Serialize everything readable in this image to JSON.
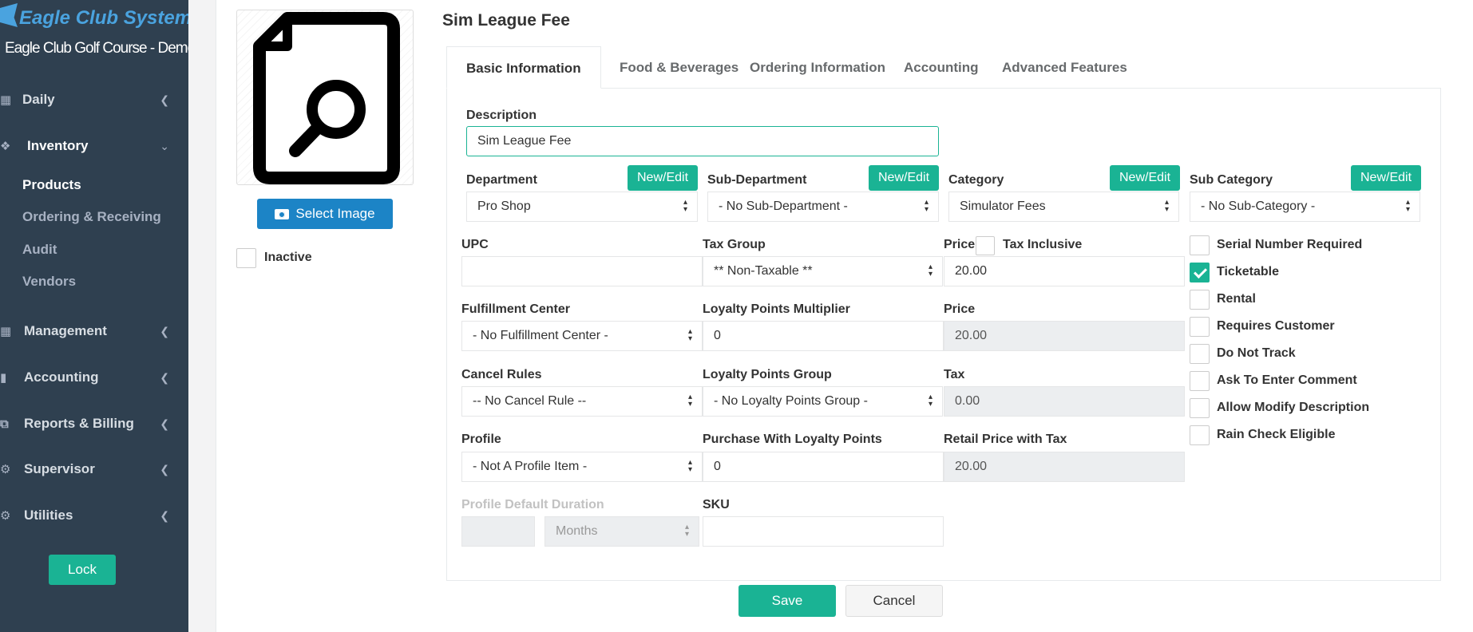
{
  "brand": {
    "name": "Eagle Club Systems",
    "subtitle": "Eagle Club Golf Course - Demo"
  },
  "sidebar": {
    "items": [
      {
        "label": "Daily",
        "icon": "calendar-icon"
      },
      {
        "label": "Inventory",
        "icon": "cubes-icon"
      },
      {
        "label": "Management",
        "icon": "grid-icon"
      },
      {
        "label": "Accounting",
        "icon": "bar-chart-icon"
      },
      {
        "label": "Reports & Billing",
        "icon": "copy-icon"
      },
      {
        "label": "Supervisor",
        "icon": "gear-icon"
      },
      {
        "label": "Utilities",
        "icon": "gear-icon"
      }
    ],
    "inventory_subitems": [
      {
        "label": "Products"
      },
      {
        "label": "Ordering & Receiving"
      },
      {
        "label": "Audit"
      },
      {
        "label": "Vendors"
      }
    ],
    "lock_label": "Lock"
  },
  "image": {
    "select_label": "Select Image",
    "inactive_label": "Inactive"
  },
  "page": {
    "title": "Sim League Fee"
  },
  "tabs": [
    {
      "label": "Basic Information"
    },
    {
      "label": "Food & Beverages"
    },
    {
      "label": "Ordering Information"
    },
    {
      "label": "Accounting"
    },
    {
      "label": "Advanced Features"
    }
  ],
  "form": {
    "new_edit_label": "New/Edit",
    "description": {
      "label": "Description",
      "value": "Sim League Fee"
    },
    "department": {
      "label": "Department",
      "value": "Pro Shop"
    },
    "sub_department": {
      "label": "Sub-Department",
      "value": "- No Sub-Department -"
    },
    "category": {
      "label": "Category",
      "value": "Simulator Fees"
    },
    "sub_category": {
      "label": "Sub Category",
      "value": "- No Sub-Category -"
    },
    "upc": {
      "label": "UPC",
      "value": ""
    },
    "tax_group": {
      "label": "Tax Group",
      "value": "** Non-Taxable **"
    },
    "price": {
      "label": "Price",
      "value": "20.00"
    },
    "tax_inclusive_label": "Tax Inclusive",
    "fulfillment_center": {
      "label": "Fulfillment Center",
      "value": "- No Fulfillment Center -"
    },
    "loyalty_multiplier": {
      "label": "Loyalty Points Multiplier",
      "value": "0"
    },
    "price_readonly": {
      "label": "Price",
      "value": "20.00"
    },
    "cancel_rules": {
      "label": "Cancel Rules",
      "value": "-- No Cancel Rule --"
    },
    "loyalty_group": {
      "label": "Loyalty Points Group",
      "value": "- No Loyalty Points Group -"
    },
    "tax": {
      "label": "Tax",
      "value": "0.00"
    },
    "profile": {
      "label": "Profile",
      "value": "- Not A Profile Item -"
    },
    "purchase_loyalty": {
      "label": "Purchase With Loyalty Points",
      "value": "0"
    },
    "retail_price_tax": {
      "label": "Retail Price with Tax",
      "value": "20.00"
    },
    "profile_duration": {
      "label": "Profile Default Duration",
      "value": "",
      "unit": "Months"
    },
    "sku": {
      "label": "SKU",
      "value": ""
    },
    "flags": [
      {
        "label": "Serial Number Required",
        "checked": false
      },
      {
        "label": "Ticketable",
        "checked": true
      },
      {
        "label": "Rental",
        "checked": false
      },
      {
        "label": "Requires Customer",
        "checked": false
      },
      {
        "label": "Do Not Track",
        "checked": false
      },
      {
        "label": "Ask To Enter Comment",
        "checked": false
      },
      {
        "label": "Allow Modify Description",
        "checked": false
      },
      {
        "label": "Rain Check Eligible",
        "checked": false
      }
    ]
  },
  "actions": {
    "save_label": "Save",
    "cancel_label": "Cancel"
  },
  "colors": {
    "sidebar": "#2f4050",
    "accent": "#1ab394",
    "primary": "#1c84c6"
  }
}
